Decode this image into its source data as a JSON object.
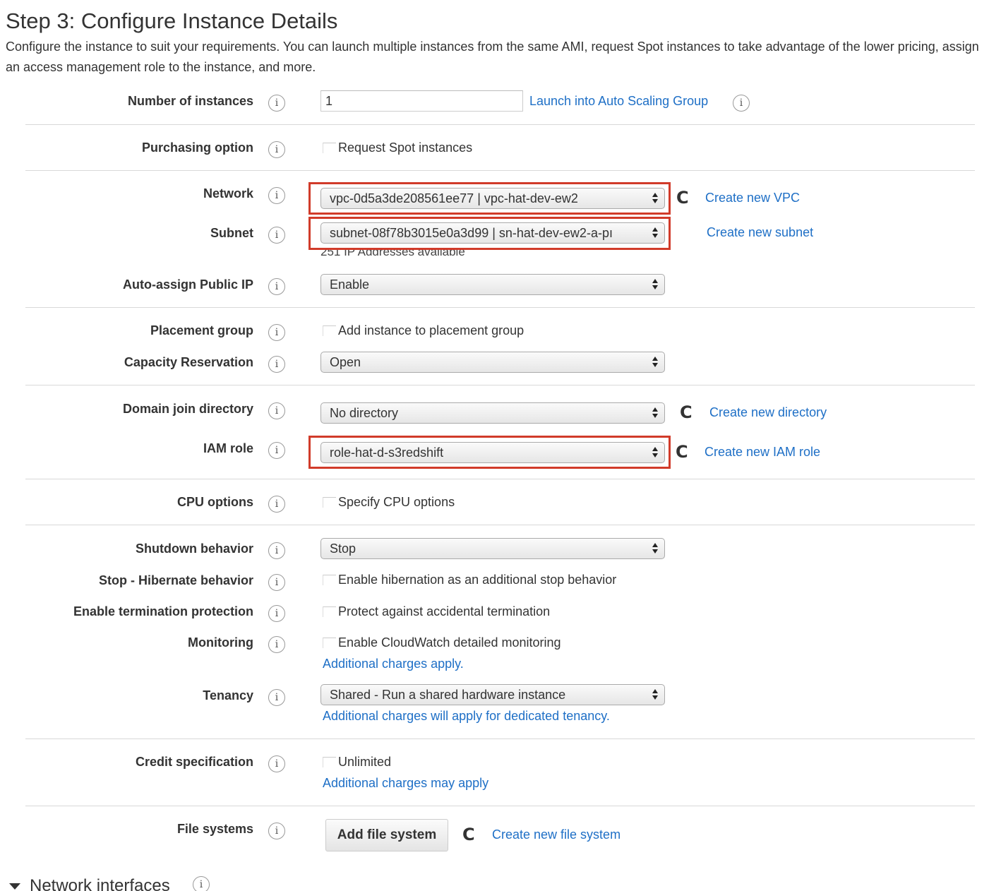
{
  "header": {
    "title": "Step 3: Configure Instance Details",
    "description": "Configure the instance to suit your requirements. You can launch multiple instances from the same AMI, request Spot instances to take advantage of the lower pricing, assign an access management role to the instance, and more."
  },
  "info_glyph": "i",
  "refresh_glyph": "C",
  "highlight_color": "#d13b2a",
  "link_color": "#1e6fc6",
  "fields": {
    "instances": {
      "label": "Number of instances",
      "value": "1",
      "link": "Launch into Auto Scaling Group"
    },
    "purchasing": {
      "label": "Purchasing option",
      "checkbox": "Request Spot instances"
    },
    "network": {
      "label": "Network",
      "value": "vpc-0d5a3de208561ee77 | vpc-hat-dev-ew2",
      "link": "Create new VPC"
    },
    "subnet": {
      "label": "Subnet",
      "value": "subnet-08f78b3015e0a3d99 | sn-hat-dev-ew2-a-pı",
      "note": "251 IP Addresses available",
      "link": "Create new subnet"
    },
    "public_ip": {
      "label": "Auto-assign Public IP",
      "value": "Enable"
    },
    "placement": {
      "label": "Placement group",
      "checkbox": "Add instance to placement group"
    },
    "capacity": {
      "label": "Capacity Reservation",
      "value": "Open"
    },
    "domain": {
      "label": "Domain join directory",
      "value": "No directory",
      "link": "Create new directory"
    },
    "iam": {
      "label": "IAM role",
      "value": "role-hat-d-s3redshift",
      "link": "Create new IAM role"
    },
    "cpu": {
      "label": "CPU options",
      "checkbox": "Specify CPU options"
    },
    "shutdown": {
      "label": "Shutdown behavior",
      "value": "Stop"
    },
    "hibernate": {
      "label": "Stop - Hibernate behavior",
      "checkbox": "Enable hibernation as an additional stop behavior"
    },
    "termination": {
      "label": "Enable termination protection",
      "checkbox": "Protect against accidental termination"
    },
    "monitoring": {
      "label": "Monitoring",
      "checkbox": "Enable CloudWatch detailed monitoring",
      "link": "Additional charges apply."
    },
    "tenancy": {
      "label": "Tenancy",
      "value": "Shared - Run a shared hardware instance",
      "link": "Additional charges will apply for dedicated tenancy."
    },
    "credit": {
      "label": "Credit specification",
      "checkbox": "Unlimited",
      "link": "Additional charges may apply"
    },
    "filesystems": {
      "label": "File systems",
      "button": "Add file system",
      "link": "Create new file system"
    }
  },
  "section": {
    "label": "Network interfaces"
  }
}
